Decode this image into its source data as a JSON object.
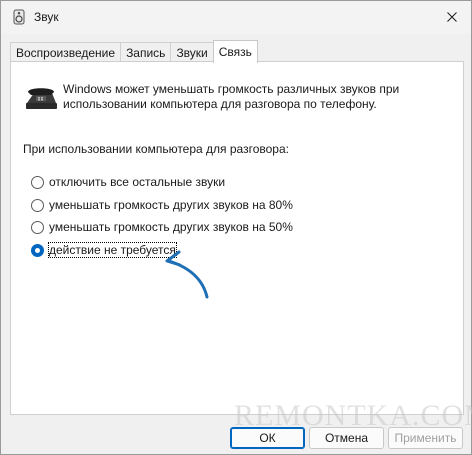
{
  "window": {
    "title": "Звук"
  },
  "tabs": [
    {
      "label": "Воспроизведение",
      "active": false
    },
    {
      "label": "Запись",
      "active": false
    },
    {
      "label": "Звуки",
      "active": false
    },
    {
      "label": "Связь",
      "active": true
    }
  ],
  "panel": {
    "description": "Windows может уменьшать громкость различных звуков при использовании компьютера для разговора по телефону.",
    "prompt": "При использовании компьютера для разговора:",
    "options": [
      {
        "label": "отключить все остальные звуки",
        "checked": false
      },
      {
        "label": "уменьшать громкость других звуков на 80%",
        "checked": false
      },
      {
        "label": "уменьшать громкость других звуков на 50%",
        "checked": false
      },
      {
        "label": "действие не требуется",
        "checked": true
      }
    ]
  },
  "buttons": {
    "ok": "ОК",
    "cancel": "Отмена",
    "apply": "Применить"
  },
  "watermark": "REMONTKA.COM",
  "colors": {
    "accent": "#0067c0",
    "arrow": "#1f6fb5"
  }
}
